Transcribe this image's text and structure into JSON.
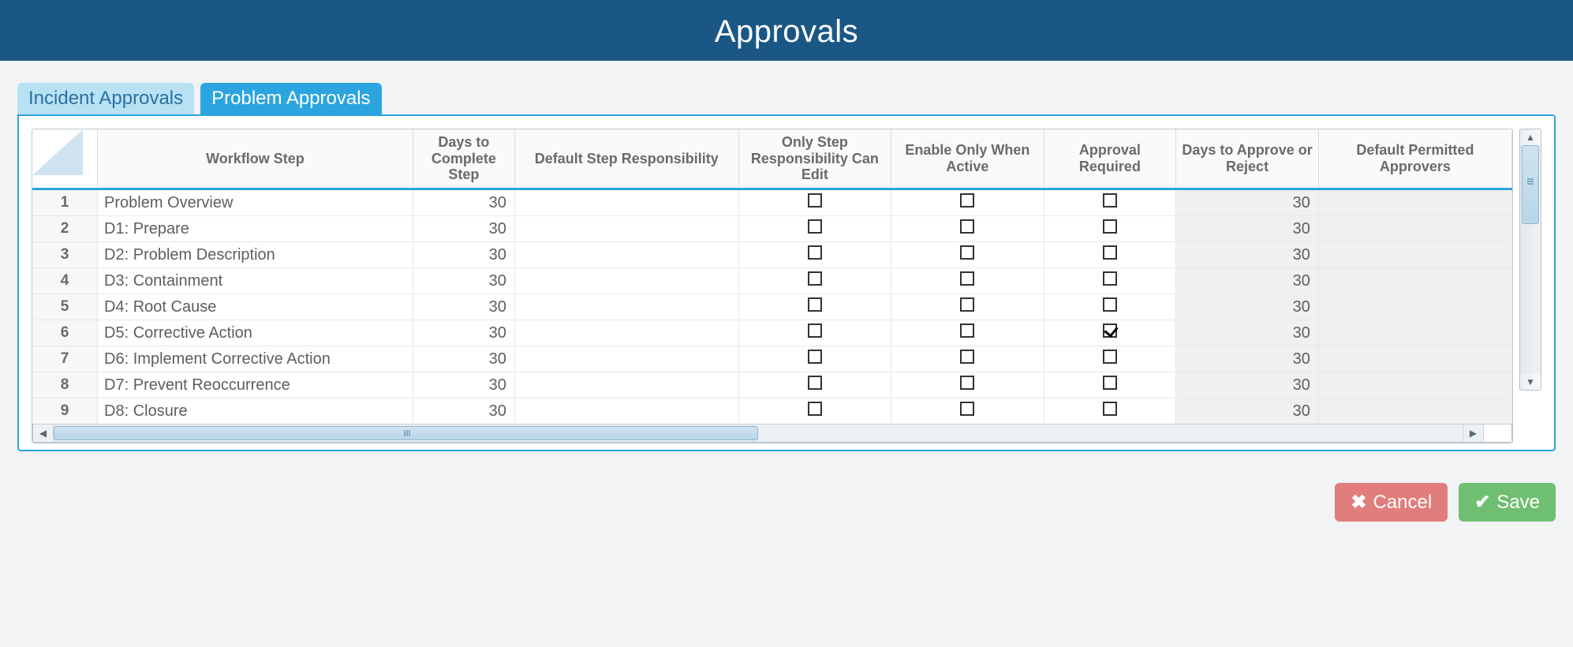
{
  "header": {
    "title": "Approvals"
  },
  "tabs": [
    {
      "label": "Incident Approvals",
      "active": false
    },
    {
      "label": "Problem Approvals",
      "active": true
    }
  ],
  "grid": {
    "columns": [
      "Workflow Step",
      "Days to Complete Step",
      "Default Step Responsibility",
      "Only Step Responsibility Can Edit",
      "Enable Only When Active",
      "Approval Required",
      "Days to Approve or Reject",
      "Default Permitted Approvers"
    ],
    "rows": [
      {
        "n": "1",
        "step": "Problem Overview",
        "days_complete": "30",
        "default_resp": "",
        "only_step_edit": false,
        "enable_active": false,
        "approval_required": false,
        "days_approve": "30",
        "permitted": ""
      },
      {
        "n": "2",
        "step": "D1: Prepare",
        "days_complete": "30",
        "default_resp": "",
        "only_step_edit": false,
        "enable_active": false,
        "approval_required": false,
        "days_approve": "30",
        "permitted": ""
      },
      {
        "n": "3",
        "step": "D2: Problem Description",
        "days_complete": "30",
        "default_resp": "",
        "only_step_edit": false,
        "enable_active": false,
        "approval_required": false,
        "days_approve": "30",
        "permitted": ""
      },
      {
        "n": "4",
        "step": "D3: Containment",
        "days_complete": "30",
        "default_resp": "",
        "only_step_edit": false,
        "enable_active": false,
        "approval_required": false,
        "days_approve": "30",
        "permitted": ""
      },
      {
        "n": "5",
        "step": "D4: Root Cause",
        "days_complete": "30",
        "default_resp": "",
        "only_step_edit": false,
        "enable_active": false,
        "approval_required": false,
        "days_approve": "30",
        "permitted": ""
      },
      {
        "n": "6",
        "step": "D5: Corrective Action",
        "days_complete": "30",
        "default_resp": "",
        "only_step_edit": false,
        "enable_active": false,
        "approval_required": true,
        "days_approve": "30",
        "permitted": ""
      },
      {
        "n": "7",
        "step": "D6: Implement Corrective Action",
        "days_complete": "30",
        "default_resp": "",
        "only_step_edit": false,
        "enable_active": false,
        "approval_required": false,
        "days_approve": "30",
        "permitted": ""
      },
      {
        "n": "8",
        "step": "D7: Prevent Reoccurrence",
        "days_complete": "30",
        "default_resp": "",
        "only_step_edit": false,
        "enable_active": false,
        "approval_required": false,
        "days_approve": "30",
        "permitted": ""
      },
      {
        "n": "9",
        "step": "D8: Closure",
        "days_complete": "30",
        "default_resp": "",
        "only_step_edit": false,
        "enable_active": false,
        "approval_required": false,
        "days_approve": "30",
        "permitted": ""
      }
    ]
  },
  "footer": {
    "cancel_label": "Cancel",
    "save_label": "Save"
  }
}
